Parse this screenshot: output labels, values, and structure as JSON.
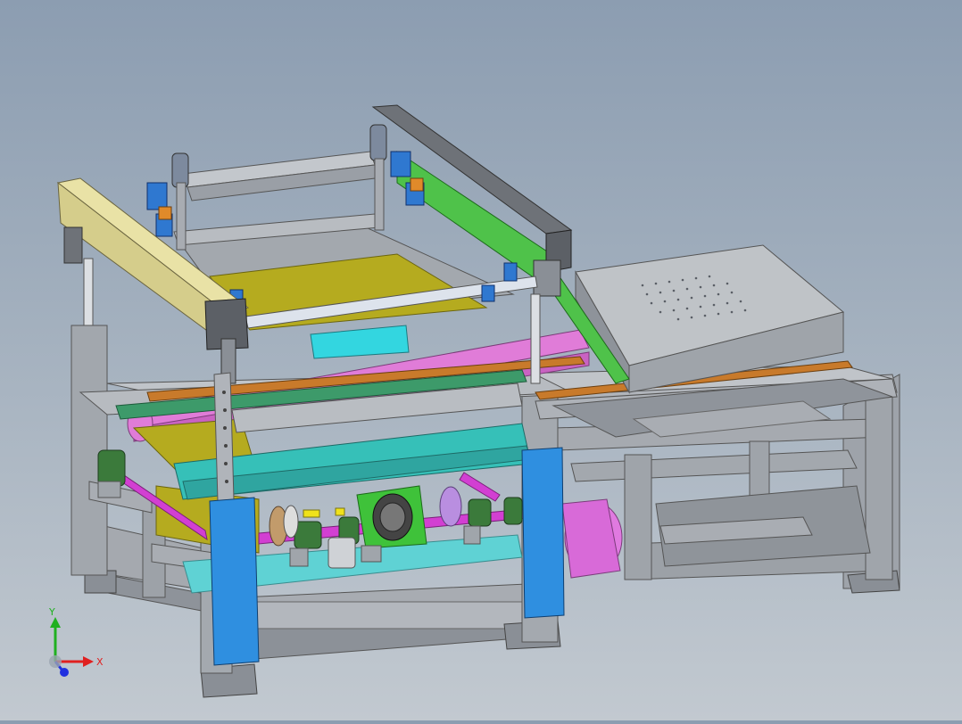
{
  "viewport": {
    "background_top": "#8c9db1",
    "background_bottom": "#c2c9d0"
  },
  "colors": {
    "frame": "#a9adb4",
    "frame_dark": "#7f858d",
    "beam_cream": "#e9e2a6",
    "gantry_green": "#4fc24a",
    "screen_olive": "#b5ab1f",
    "pink_belt": "#e07cd8",
    "cyan_plate": "#5fd2d4",
    "blue_guard": "#2f8fe0",
    "motor_pink": "#e07ae0",
    "gearbox_green": "#3fc23a",
    "table_grey": "#b4b8bc",
    "shaft_magenta": "#d23fd2"
  },
  "triad": {
    "x_label": "X",
    "y_label": "Y",
    "x_color": "#e02020",
    "y_color": "#20b020",
    "z_color": "#2030e0"
  }
}
